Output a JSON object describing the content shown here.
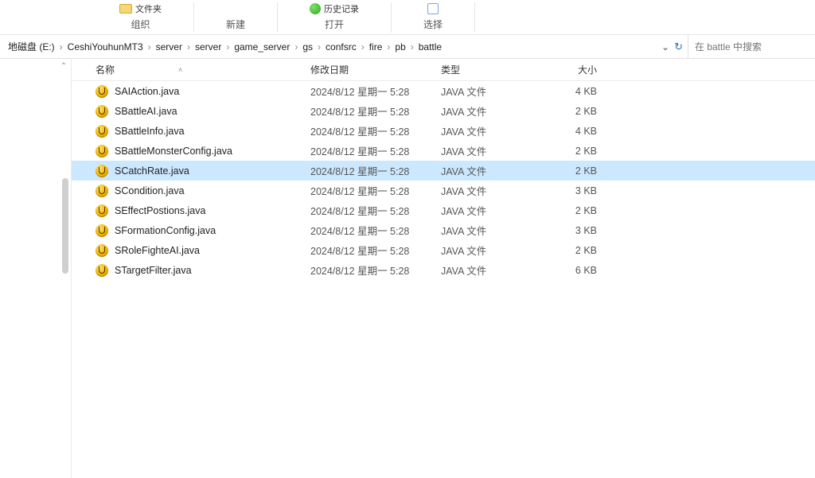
{
  "toolbar": {
    "group1_upper": "文件夹",
    "group1_label": "组织",
    "group2_label": "新建",
    "group3_upper": "历史记录",
    "group3_label": "打开",
    "group4_label": "选择"
  },
  "breadcrumbs": [
    "地磁盘 (E:)",
    "CeshiYouhunMT3",
    "server",
    "server",
    "game_server",
    "gs",
    "confsrc",
    "fire",
    "pb",
    "battle"
  ],
  "search": {
    "placeholder": "在 battle 中搜索"
  },
  "columns": {
    "name": "名称",
    "date": "修改日期",
    "type": "类型",
    "size": "大小"
  },
  "files": [
    {
      "name": "SAIAction.java",
      "date": "2024/8/12 星期一 5:28",
      "type": "JAVA 文件",
      "size": "4 KB",
      "selected": false
    },
    {
      "name": "SBattleAI.java",
      "date": "2024/8/12 星期一 5:28",
      "type": "JAVA 文件",
      "size": "2 KB",
      "selected": false
    },
    {
      "name": "SBattleInfo.java",
      "date": "2024/8/12 星期一 5:28",
      "type": "JAVA 文件",
      "size": "4 KB",
      "selected": false
    },
    {
      "name": "SBattleMonsterConfig.java",
      "date": "2024/8/12 星期一 5:28",
      "type": "JAVA 文件",
      "size": "2 KB",
      "selected": false
    },
    {
      "name": "SCatchRate.java",
      "date": "2024/8/12 星期一 5:28",
      "type": "JAVA 文件",
      "size": "2 KB",
      "selected": true
    },
    {
      "name": "SCondition.java",
      "date": "2024/8/12 星期一 5:28",
      "type": "JAVA 文件",
      "size": "3 KB",
      "selected": false
    },
    {
      "name": "SEffectPostions.java",
      "date": "2024/8/12 星期一 5:28",
      "type": "JAVA 文件",
      "size": "2 KB",
      "selected": false
    },
    {
      "name": "SFormationConfig.java",
      "date": "2024/8/12 星期一 5:28",
      "type": "JAVA 文件",
      "size": "3 KB",
      "selected": false
    },
    {
      "name": "SRoleFighteAI.java",
      "date": "2024/8/12 星期一 5:28",
      "type": "JAVA 文件",
      "size": "2 KB",
      "selected": false
    },
    {
      "name": "STargetFilter.java",
      "date": "2024/8/12 星期一 5:28",
      "type": "JAVA 文件",
      "size": "6 KB",
      "selected": false
    }
  ]
}
